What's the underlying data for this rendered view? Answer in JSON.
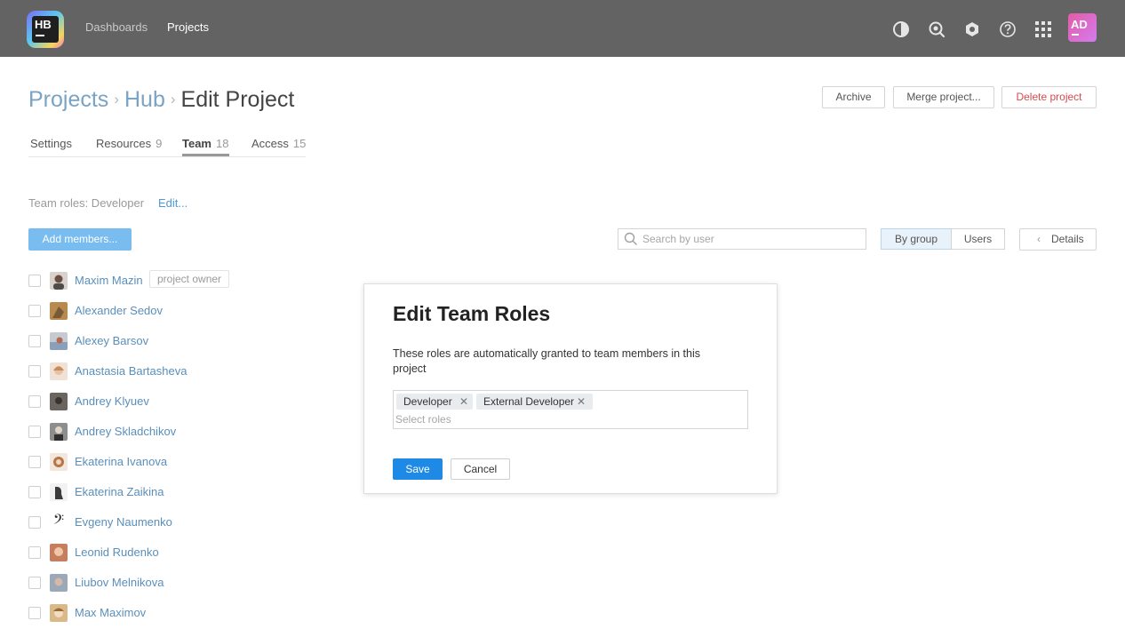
{
  "topbar": {
    "logo_text": "HB",
    "nav": [
      {
        "label": "Dashboards",
        "active": false
      },
      {
        "label": "Projects",
        "active": true
      }
    ],
    "icons": [
      "contrast-icon",
      "search-icon",
      "settings-icon",
      "help-icon",
      "apps-grid-icon"
    ],
    "user_initials": "AD"
  },
  "breadcrumb": {
    "root": "Projects",
    "parent": "Hub",
    "separator": "›",
    "current": "Edit Project"
  },
  "actions": {
    "archive": "Archive",
    "merge": "Merge project...",
    "delete": "Delete project"
  },
  "tabs": [
    {
      "label": "Settings",
      "count": ""
    },
    {
      "label": "Resources",
      "count": "9"
    },
    {
      "label": "Team",
      "count": "18"
    },
    {
      "label": "Access",
      "count": "15"
    }
  ],
  "team": {
    "roles_label": "Team roles: Developer",
    "edit_link": "Edit...",
    "add_members": "Add members...",
    "search_placeholder": "Search by user",
    "view_by_group": "By group",
    "view_users": "Users",
    "details": "Details",
    "owner_badge": "project owner"
  },
  "members": [
    "Maxim Mazin",
    "Alexander Sedov",
    "Alexey Barsov",
    "Anastasia Bartasheva",
    "Andrey Klyuev",
    "Andrey Skladchikov",
    "Ekaterina Ivanova",
    "Ekaterina Zaikina",
    "Evgeny Naumenko",
    "Leonid Rudenko",
    "Liubov Melnikova",
    "Max Maximov"
  ],
  "modal": {
    "title": "Edit Team Roles",
    "description": "These roles are automatically granted to team members in this project",
    "roles": [
      "Developer",
      "External Developer"
    ],
    "roles_placeholder": "Select roles",
    "save": "Save",
    "cancel": "Cancel"
  },
  "colors": {
    "topbar": "#636363",
    "link": "#5a8fbb",
    "primary": "#1e8ae6",
    "danger": "#d64b4b"
  }
}
